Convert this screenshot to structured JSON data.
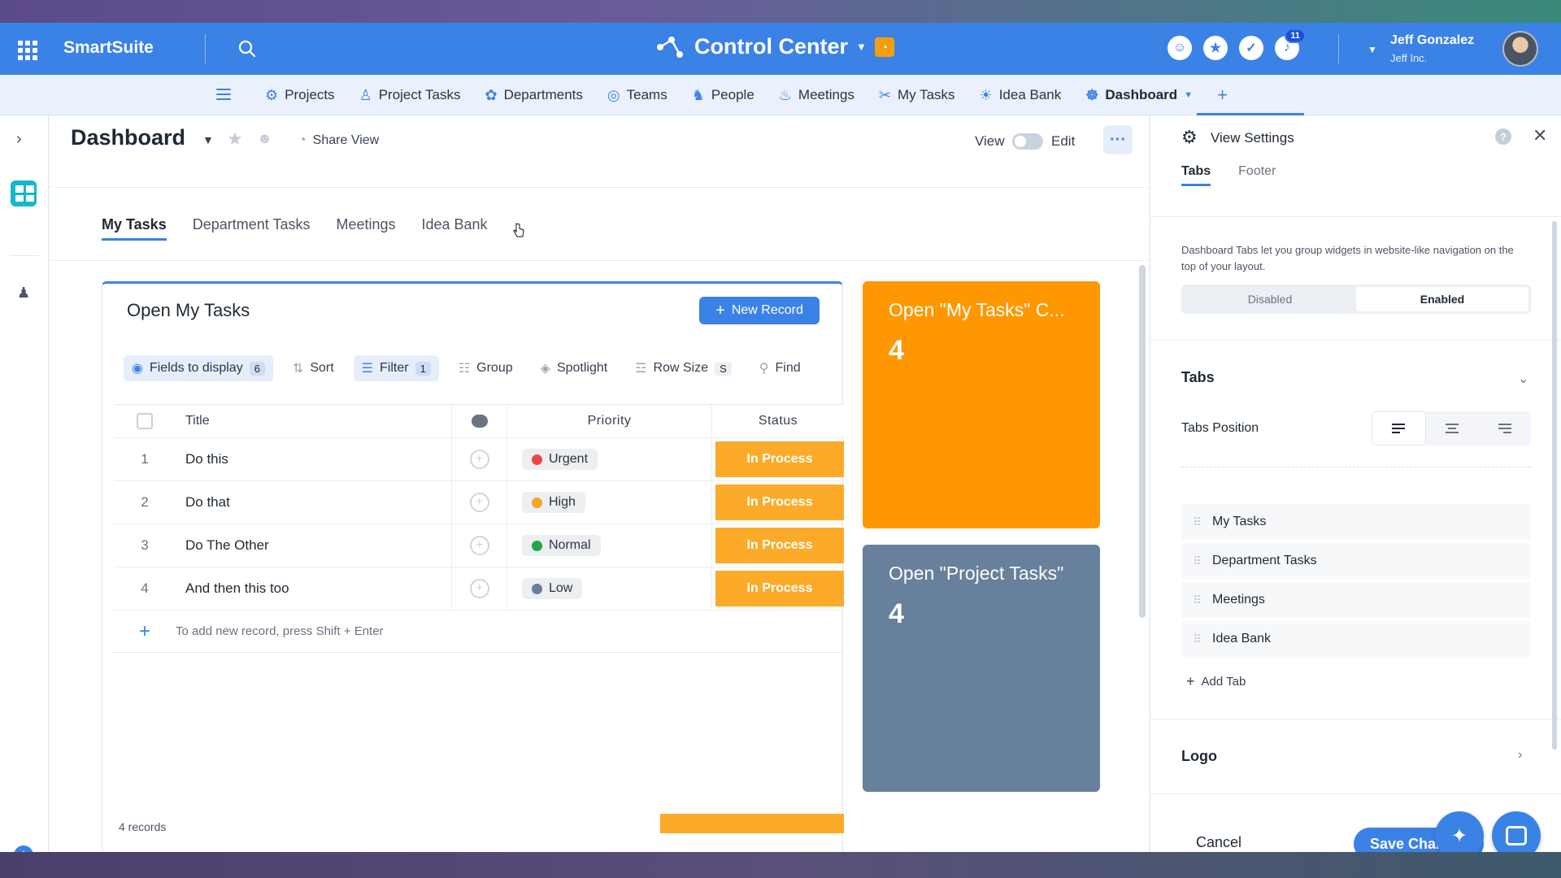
{
  "topbar": {
    "brand": "SmartSuite",
    "center_title": "Control Center",
    "notification_count": "11",
    "user_name": "Jeff Gonzalez",
    "user_org": "Jeff Inc."
  },
  "modules": [
    {
      "label": "Projects",
      "icon": "projects-icon"
    },
    {
      "label": "Project Tasks",
      "icon": "person-walking-icon"
    },
    {
      "label": "Departments",
      "icon": "departments-icon"
    },
    {
      "label": "Teams",
      "icon": "teams-icon"
    },
    {
      "label": "People",
      "icon": "people-icon"
    },
    {
      "label": "Meetings",
      "icon": "meetings-icon"
    },
    {
      "label": "My Tasks",
      "icon": "tools-icon"
    },
    {
      "label": "Idea Bank",
      "icon": "lightbulb-icon"
    },
    {
      "label": "Dashboard",
      "icon": "dashboard-icon"
    }
  ],
  "main": {
    "title": "Dashboard",
    "share_view": "Share View",
    "view_label": "View",
    "edit_label": "Edit",
    "tabs": [
      "My Tasks",
      "Department Tasks",
      "Meetings",
      "Idea Bank"
    ]
  },
  "widget": {
    "title": "Open My Tasks",
    "new_record": "New Record",
    "toolbar": {
      "fields": "Fields to display",
      "fields_count": "6",
      "sort": "Sort",
      "filter": "Filter",
      "filter_count": "1",
      "group": "Group",
      "spotlight": "Spotlight",
      "row_size": "Row Size",
      "row_size_value": "S",
      "find": "Find"
    },
    "columns": {
      "title": "Title",
      "priority": "Priority",
      "status": "Status"
    },
    "rows": [
      {
        "num": "1",
        "title": "Do this",
        "priority": "Urgent",
        "priority_color": "#ef4444",
        "status": "In Process"
      },
      {
        "num": "2",
        "title": "Do that",
        "priority": "High",
        "priority_color": "#f5a623",
        "status": "In Process"
      },
      {
        "num": "3",
        "title": "Do The Other",
        "priority": "Normal",
        "priority_color": "#22a447",
        "status": "In Process"
      },
      {
        "num": "4",
        "title": "And then this too",
        "priority": "Low",
        "priority_color": "#6b7f99",
        "status": "In Process"
      }
    ],
    "add_hint": "To add new record, press Shift + Enter",
    "records": "4 records"
  },
  "cards": [
    {
      "title": "Open \"My Tasks\" C...",
      "value": "4",
      "color": "#ff9800"
    },
    {
      "title": "Open \"Project Tasks\"",
      "value": "4",
      "color": "#67809b"
    }
  ],
  "settings": {
    "title": "View Settings",
    "tabs": [
      "Tabs",
      "Footer"
    ],
    "description": "Dashboard Tabs let you group widgets in website-like navigation on the top of your layout.",
    "seg_disabled": "Disabled",
    "seg_enabled": "Enabled",
    "section_tabs": "Tabs",
    "tabs_position": "Tabs Position",
    "tab_list": [
      "My Tasks",
      "Department Tasks",
      "Meetings",
      "Idea Bank"
    ],
    "add_tab": "Add Tab",
    "section_logo": "Logo",
    "cancel": "Cancel",
    "save": "Save Chan"
  },
  "colors": {
    "accent": "#3b82e6",
    "status": "#fbaa2a"
  }
}
